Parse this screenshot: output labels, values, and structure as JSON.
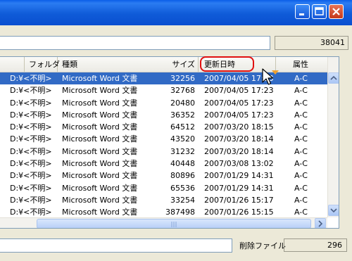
{
  "window": {
    "minimize_icon": "minimize-icon",
    "maximize_icon": "maximize-icon",
    "close_icon": "close-icon"
  },
  "file_count": "38041",
  "columns": {
    "folder": "フォルダ",
    "type": "種類",
    "size": "サイズ",
    "modified": "更新日時",
    "attributes": "属性"
  },
  "rows": [
    {
      "folder": "D:¥<不明>",
      "type": "Microsoft Word 文書",
      "size": "32256",
      "modified": "2007/04/05 17:23",
      "attr": "A-C"
    },
    {
      "folder": "D:¥<不明>",
      "type": "Microsoft Word 文書",
      "size": "32768",
      "modified": "2007/04/05 17:23",
      "attr": "A-C"
    },
    {
      "folder": "D:¥<不明>",
      "type": "Microsoft Word 文書",
      "size": "20480",
      "modified": "2007/04/05 17:23",
      "attr": "A-C"
    },
    {
      "folder": "D:¥<不明>",
      "type": "Microsoft Word 文書",
      "size": "36352",
      "modified": "2007/04/05 17:23",
      "attr": "A-C"
    },
    {
      "folder": "D:¥<不明>",
      "type": "Microsoft Word 文書",
      "size": "64512",
      "modified": "2007/03/20 18:15",
      "attr": "A-C"
    },
    {
      "folder": "D:¥<不明>",
      "type": "Microsoft Word 文書",
      "size": "43520",
      "modified": "2007/03/20 18:14",
      "attr": "A-C"
    },
    {
      "folder": "D:¥<不明>",
      "type": "Microsoft Word 文書",
      "size": "31232",
      "modified": "2007/03/20 18:14",
      "attr": "A-C"
    },
    {
      "folder": "D:¥<不明>",
      "type": "Microsoft Word 文書",
      "size": "40448",
      "modified": "2007/03/08 13:02",
      "attr": "A-C"
    },
    {
      "folder": "D:¥<不明>",
      "type": "Microsoft Word 文書",
      "size": "80896",
      "modified": "2007/01/29 14:31",
      "attr": "A-C"
    },
    {
      "folder": "D:¥<不明>",
      "type": "Microsoft Word 文書",
      "size": "65536",
      "modified": "2007/01/29 14:31",
      "attr": "A-C"
    },
    {
      "folder": "D:¥<不明>",
      "type": "Microsoft Word 文書",
      "size": "33254",
      "modified": "2007/01/26 15:17",
      "attr": "A-C"
    },
    {
      "folder": "D:¥<不明>",
      "type": "Microsoft Word 文書",
      "size": "387498",
      "modified": "2007/01/26 15:15",
      "attr": "A-C"
    }
  ],
  "deleted_files_label": "削除ファイル",
  "deleted_files_count": "296",
  "colors": {
    "selection": "#316ac5",
    "highlight_ring": "#e01010",
    "titlebar": "#0a5ee8"
  }
}
